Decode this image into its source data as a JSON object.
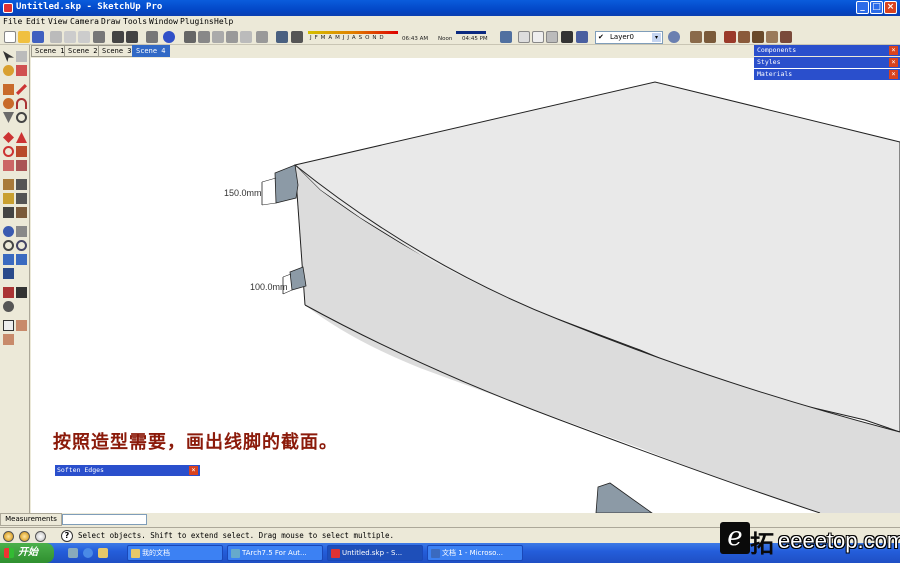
{
  "window": {
    "title": "Untitled.skp - SketchUp Pro",
    "minimize": "_",
    "maximize": "□",
    "close": "×"
  },
  "menu": [
    "File",
    "Edit",
    "View",
    "Camera",
    "Draw",
    "Tools",
    "Window",
    "Plugins",
    "Help"
  ],
  "toolbar": {
    "shadow_months": "J F M A M J J A S O N D",
    "shadow_time_start": "06:43 AM",
    "shadow_time_noon": "Noon",
    "shadow_time_end": "04:45 PM",
    "layer": "Layer0",
    "layer_check": "✔",
    "layer_arrow": "▾"
  },
  "scenes": [
    "Scene 1",
    "Scene 2",
    "Scene 3",
    "Scene 4"
  ],
  "active_scene": "Scene 4",
  "viewport": {
    "dim_top": "150.0mm",
    "dim_bottom": "100.0mm",
    "annotation": "按照造型需要，画出线脚的截面。"
  },
  "panels": [
    "Components",
    "Styles",
    "Materials"
  ],
  "panel_close": "×",
  "soften_edges": "Soften Edges",
  "measurements_label": "Measurements",
  "status_text": "Select objects. Shift to extend select. Drag mouse to select multiple.",
  "help_glyph": "?",
  "taskbar": {
    "start": "开始",
    "tasks": [
      "我的文档",
      "TArch7.5 For Aut...",
      "Untitled.skp - S...",
      "文档 1 - Microso..."
    ],
    "active_task": "Untitled.skp - S..."
  },
  "watermark": {
    "e": "e",
    "tuo": "拓",
    "site": "eeeetop.com"
  },
  "colors": {
    "titlebar": "#0348c8",
    "panel_header": "#2a4fcc",
    "annotation": "#8b1a0a",
    "model_top": "#e9e9e9",
    "model_side": "#dcdcdc",
    "profile": "#8c9aa6"
  }
}
